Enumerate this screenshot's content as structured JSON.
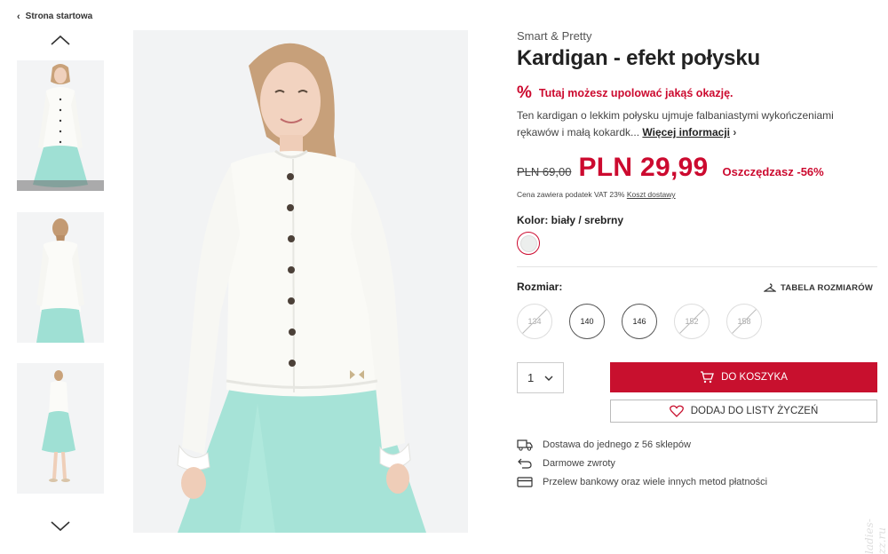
{
  "nav": {
    "back_label": "Strona startowa"
  },
  "product": {
    "brand": "Smart & Pretty",
    "title": "Kardigan - efekt połysku",
    "promo": "Tutaj możesz upolować jakąś okazję.",
    "description": "Ten kardigan o lekkim połysku ujmuje falbaniastymi wykończeniami rękawów i małą kokardk...",
    "more_label": "Więcej informacji",
    "old_price": "PLN 69,00",
    "new_price": "PLN 29,99",
    "savings": "Oszczędzasz -56%",
    "vat_text": "Cena zawiera podatek VAT 23%",
    "shipping_label": "Koszt dostawy",
    "color_label": "Kolor: biały / srebrny",
    "size_label": "Rozmiar:",
    "size_table_label": "TABELA ROZMIARÓW",
    "sizes": [
      {
        "label": "134",
        "available": false
      },
      {
        "label": "140",
        "available": true
      },
      {
        "label": "146",
        "available": true
      },
      {
        "label": "152",
        "available": false
      },
      {
        "label": "158",
        "available": false
      }
    ],
    "quantity": "1",
    "cart_label": "DO KOSZYKA",
    "wishlist_label": "DODAJ DO LISTY ŻYCZEŃ"
  },
  "info": {
    "delivery": "Dostawa do jednego z 56 sklepów",
    "returns": "Darmowe zwroty",
    "payment": "Przelew bankowy oraz wiele innych metod płatności"
  },
  "colors": {
    "accent": "#c8102e",
    "promo": "#cc0a2f"
  },
  "watermark": "ladies-zz.ru"
}
